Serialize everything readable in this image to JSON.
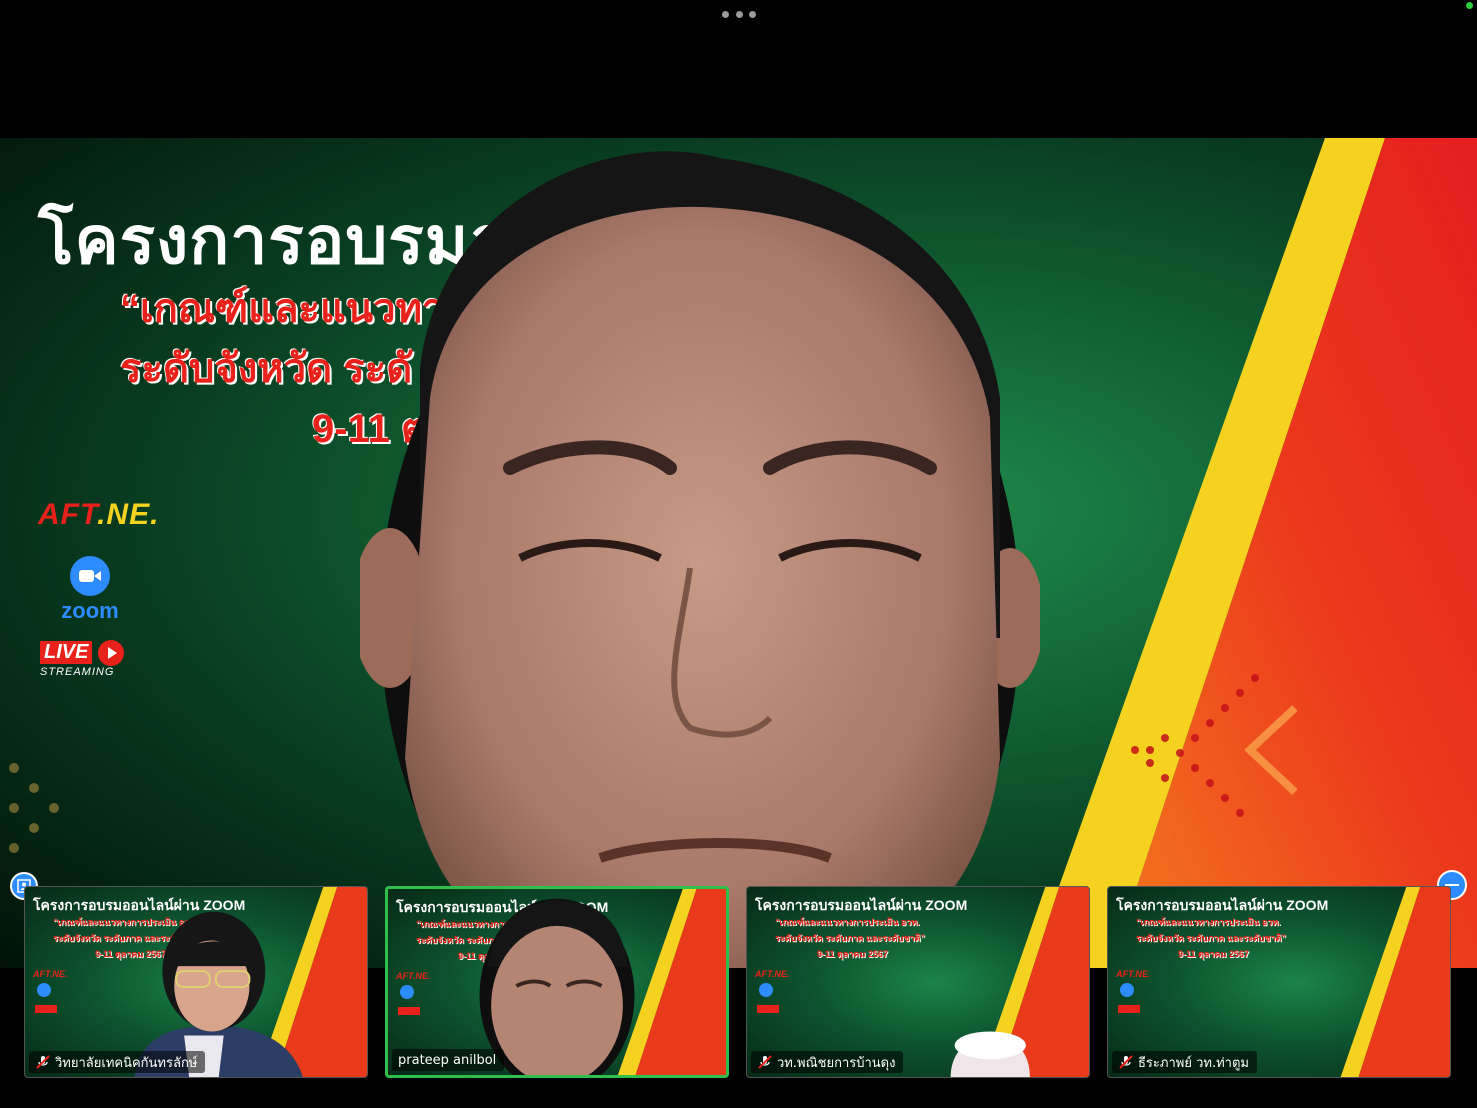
{
  "window": {
    "menu_icon": "more-horizontal-icon"
  },
  "main_speaker": {
    "slide": {
      "title": "โครงการอบรมออนไ",
      "subtitle_line1": "“เกณฑ์และแนวทา",
      "subtitle_line2": "ระดับจังหวัด ระดั",
      "subtitle_line3": "9-11 ตุ",
      "logo_aft": "AFT",
      "logo_ne": ".NE.",
      "zoom_label": "zoom",
      "live_label": "LIVE",
      "streaming_label": "STREAMING"
    }
  },
  "thumb_slide": {
    "title": "โครงการอบรมออนไลน์ผ่าน ZOOM",
    "line1": "“เกณฑ์และแนวทางการประเมิน อวท.",
    "line2": "ระดับจังหวัด ระดับภาค และระดับชาติ”",
    "line3": "9-11 ตุลาคม 2567",
    "aft": "AFT.NE."
  },
  "filmstrip": {
    "pin_icon": "person-pin-icon",
    "collapse_icon": "minus-icon",
    "participants": [
      {
        "name": "วิทยาลัยเทคนิคกันทรลักษ์",
        "muted": true,
        "video": true
      },
      {
        "name": "prateep anilbol",
        "muted": false,
        "video": true,
        "active_speaker": true
      },
      {
        "name": "วท.พณิชยการบ้านดุง",
        "muted": true,
        "video": true
      },
      {
        "name": "ธีระภาพย์ วท.ท่าตูม",
        "muted": true,
        "video": false
      }
    ]
  },
  "colors": {
    "zoom_blue": "#2d8cff",
    "active_border": "#2fbf4a",
    "slide_red": "#e8221a",
    "slide_yellow": "#f4d21f",
    "slide_green": "#0f5a30"
  }
}
